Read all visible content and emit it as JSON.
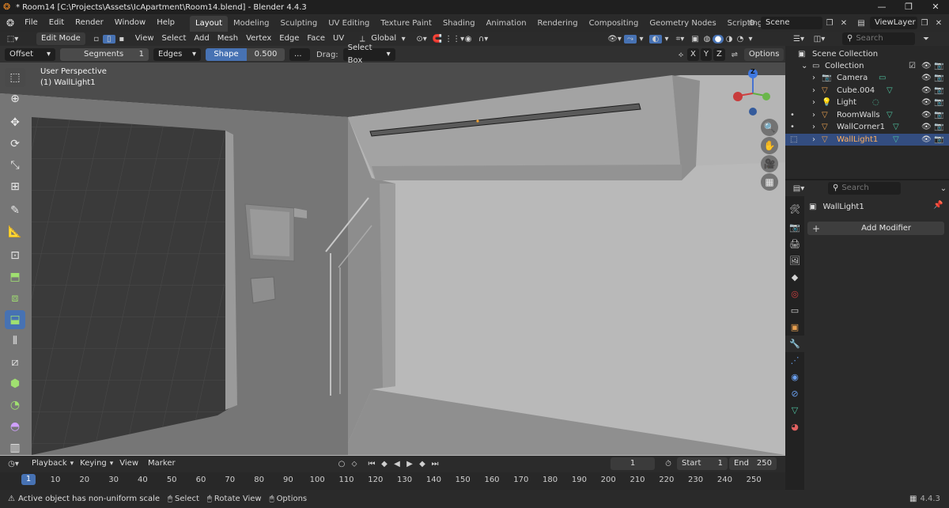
{
  "window": {
    "title": "* Room14 [C:\\Projects\\Assets\\IcApartment\\Room14.blend] - Blender 4.4.3",
    "controls": [
      "—",
      "❐",
      "✕"
    ]
  },
  "menus": [
    "File",
    "Edit",
    "Render",
    "Window",
    "Help"
  ],
  "workspaces": [
    "Layout",
    "Modeling",
    "Sculpting",
    "UV Editing",
    "Texture Paint",
    "Shading",
    "Animation",
    "Rendering",
    "Compositing",
    "Geometry Nodes",
    "Scripting"
  ],
  "workspace_add": "+",
  "scene": {
    "label": "Scene",
    "view_layer": "ViewLayer"
  },
  "viewport_header": {
    "mode": "Edit Mode",
    "menus": [
      "View",
      "Select",
      "Add",
      "Mesh",
      "Vertex",
      "Edge",
      "Face",
      "UV"
    ],
    "transform_orientation": "Global"
  },
  "operator_bar": {
    "offset": "Offset",
    "segments_label": "Segments",
    "segments_value": "1",
    "affect": "Edges",
    "shape_label": "Shape",
    "shape_value": "0.500",
    "more": "...",
    "drag_label": "Drag:",
    "drag_value": "Select Box",
    "axes": [
      "X",
      "Y",
      "Z"
    ],
    "options": "Options"
  },
  "viewport": {
    "perspective": "User Perspective",
    "active_object": "(1) WallLight1"
  },
  "gizmo": {
    "z": "Z"
  },
  "outliner": {
    "search_placeholder": "Search",
    "scene_collection": "Scene Collection",
    "collection": "Collection",
    "items": [
      {
        "name": "Camera",
        "type": "camera"
      },
      {
        "name": "Cube.004",
        "type": "mesh"
      },
      {
        "name": "Light",
        "type": "light"
      },
      {
        "name": "RoomWalls",
        "type": "mesh"
      },
      {
        "name": "WallCorner1",
        "type": "mesh"
      },
      {
        "name": "WallLight1",
        "type": "mesh",
        "selected": true
      }
    ]
  },
  "properties": {
    "search_placeholder": "Search",
    "object_name": "WallLight1",
    "add_modifier": "Add Modifier"
  },
  "timeline_header": {
    "menus": [
      "Playback",
      "Keying",
      "View",
      "Marker"
    ],
    "current_frame": "1",
    "start_label": "Start",
    "start_value": "1",
    "end_label": "End",
    "end_value": "250"
  },
  "timeline": {
    "current": "1",
    "ticks": [
      "10",
      "20",
      "30",
      "40",
      "50",
      "60",
      "70",
      "80",
      "90",
      "100",
      "110",
      "120",
      "130",
      "140",
      "150",
      "160",
      "170",
      "180",
      "190",
      "200",
      "210",
      "220",
      "230",
      "240",
      "250"
    ]
  },
  "statusbar": {
    "message": "Active object has non-uniform scale",
    "select": "Select",
    "rotate": "Rotate View",
    "options": "Options",
    "version": "4.4.3"
  },
  "colors": {
    "accent": "#4772b3",
    "selected_row": "#334d80",
    "mesh_icon": "#e8a050",
    "data_icon": "#4fc3a1"
  }
}
